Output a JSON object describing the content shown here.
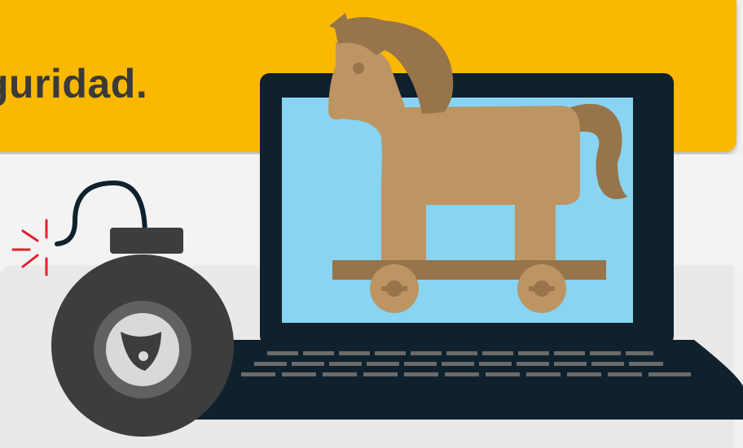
{
  "banner": {
    "title": "guridad.",
    "background_color": "#fbb800",
    "text_color": "#3a3a3a"
  },
  "illustration": {
    "laptop": {
      "frame_color": "#0f212c",
      "screen_color": "#88d4f2",
      "key_color": "#6b6b6b"
    },
    "trojan_horse": {
      "body_color": "#bc9562",
      "mane_color": "#97744a"
    },
    "bomb": {
      "body_color": "#3d3d3d",
      "ring_color": "#616161",
      "emblem_color": "#d9d9d9"
    },
    "spark_color": "#e0202a",
    "icons": [
      "laptop-icon",
      "trojan-horse-icon",
      "bomb-icon",
      "spark-icon"
    ]
  }
}
